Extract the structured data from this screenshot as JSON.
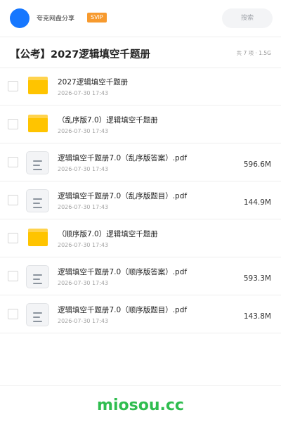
{
  "header": {
    "share_name": "夸克网盘分享",
    "badge": "SVIP",
    "search_placeholder": "搜索"
  },
  "folder": {
    "title": "【公考】2027逻辑填空千题册",
    "meta": "共 7 项 · 1.5G"
  },
  "files": [
    {
      "type": "folder",
      "name": "2027逻辑填空千题册",
      "date": "2026-07-30 17:43",
      "size": ""
    },
    {
      "type": "folder",
      "name": "（乱序版7.0）逻辑填空千题册",
      "date": "2026-07-30 17:43",
      "size": ""
    },
    {
      "type": "file",
      "name": "逻辑填空千题册7.0（乱序版答案）.pdf",
      "date": "2026-07-30 17:43",
      "size": "596.6M"
    },
    {
      "type": "file",
      "name": "逻辑填空千题册7.0（乱序版题目）.pdf",
      "date": "2026-07-30 17:43",
      "size": "144.9M"
    },
    {
      "type": "folder",
      "name": "（顺序版7.0）逻辑填空千题册",
      "date": "2026-07-30 17:43",
      "size": ""
    },
    {
      "type": "file",
      "name": "逻辑填空千题册7.0（顺序版答案）.pdf",
      "date": "2026-07-30 17:43",
      "size": "593.3M"
    },
    {
      "type": "file",
      "name": "逻辑填空千题册7.0（顺序版题目）.pdf",
      "date": "2026-07-30 17:43",
      "size": "143.8M"
    }
  ],
  "footer": {
    "brand": "miosou.cc"
  },
  "colors": {
    "avatar": "#1677ff",
    "badge": "#f79a2e",
    "folder": "#ffc400",
    "brand": "#2fbd4f"
  }
}
